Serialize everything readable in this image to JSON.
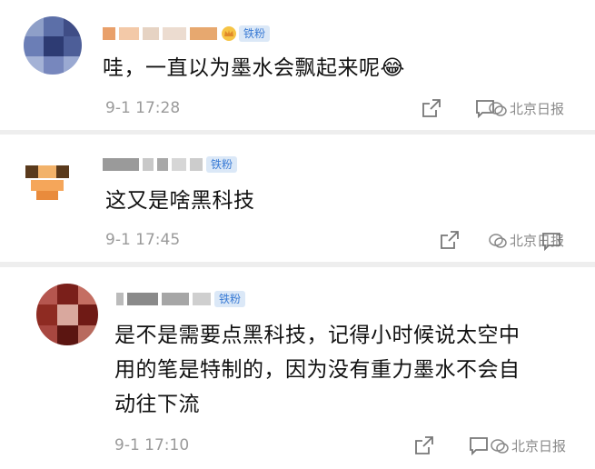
{
  "comments": [
    {
      "badge": "铁粉",
      "text": "哇，一直以为墨水会飘起来呢😂",
      "time": "9-1 17:28",
      "watermark": "北京日报",
      "icons": [
        "share-icon",
        "comment-icon",
        "wechat-icon"
      ]
    },
    {
      "badge": "铁粉",
      "text": "这又是啥黑科技",
      "time": "9-1 17:45",
      "watermark": "北京日报",
      "icons": [
        "share-icon",
        "comment-icon",
        "wechat-icon"
      ]
    },
    {
      "badge": "铁粉",
      "text_lines": [
        "是不是需要点黑科技，记得小时候说太空中",
        "用的笔是特制的，因为没有重力墨水不会自",
        "动往下流"
      ],
      "time": "9-1 17:10",
      "watermark": "北京日报",
      "icons": [
        "share-icon",
        "comment-icon",
        "wechat-icon"
      ]
    }
  ],
  "colors": {
    "badge_bg": "#dbe8f7",
    "badge_text": "#3a7bd5",
    "time": "#9a9a9a",
    "separator": "#eeeeee"
  }
}
